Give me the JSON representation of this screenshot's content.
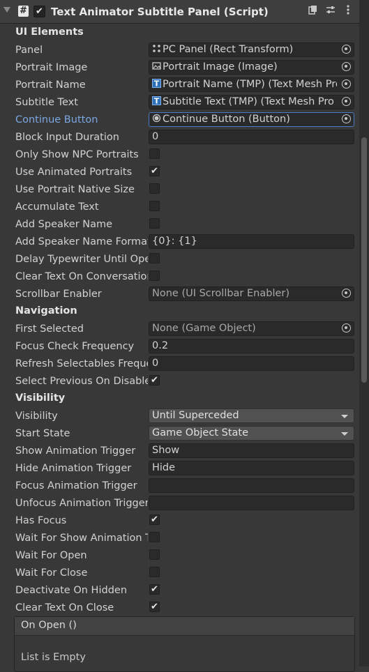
{
  "header": {
    "title": "Text Animator Subtitle Panel (Script)",
    "enabled": "✔"
  },
  "sections": {
    "ui": "UI Elements",
    "nav": "Navigation",
    "vis": "Visibility"
  },
  "rows": {
    "panel": {
      "label": "Panel",
      "value": "PC Panel (Rect Transform)"
    },
    "portrait_image": {
      "label": "Portrait Image",
      "value": "Portrait Image (Image)"
    },
    "portrait_name": {
      "label": "Portrait Name",
      "value": "Portrait Name (TMP) (Text Mesh Pro"
    },
    "subtitle_text": {
      "label": "Subtitle Text",
      "value": "Subtitle Text (TMP) (Text Mesh Pro"
    },
    "continue_button": {
      "label": "Continue Button",
      "value": "Continue Button (Button)"
    },
    "block_input": {
      "label": "Block Input Duration",
      "value": "0"
    },
    "only_npc": {
      "label": "Only Show NPC Portraits",
      "checked": ""
    },
    "use_animated": {
      "label": "Use Animated Portraits",
      "checked": "✔"
    },
    "native_size": {
      "label": "Use Portrait Native Size",
      "checked": ""
    },
    "accumulate": {
      "label": "Accumulate Text",
      "checked": ""
    },
    "add_speaker": {
      "label": "Add Speaker Name",
      "checked": ""
    },
    "speaker_format": {
      "label": "Add Speaker Name Format",
      "value": "{0}: {1}"
    },
    "delay_typewriter": {
      "label": "Delay Typewriter Until Open",
      "checked": ""
    },
    "clear_on_conv": {
      "label": "Clear Text On Conversation",
      "checked": ""
    },
    "scrollbar_enabler": {
      "label": "Scrollbar Enabler",
      "value": "None (UI Scrollbar Enabler)"
    },
    "first_selected": {
      "label": "First Selected",
      "value": "None (Game Object)"
    },
    "focus_freq": {
      "label": "Focus Check Frequency",
      "value": "0.2"
    },
    "refresh_freq": {
      "label": "Refresh Selectables Frequency",
      "value": "0"
    },
    "select_prev": {
      "label": "Select Previous On Disable",
      "checked": "✔"
    },
    "visibility": {
      "label": "Visibility",
      "value": "Until Superceded"
    },
    "start_state": {
      "label": "Start State",
      "value": "Game Object State"
    },
    "show_trigger": {
      "label": "Show Animation Trigger",
      "value": "Show"
    },
    "hide_trigger": {
      "label": "Hide Animation Trigger",
      "value": "Hide"
    },
    "focus_trigger": {
      "label": "Focus Animation Trigger",
      "value": ""
    },
    "unfocus_trigger": {
      "label": "Unfocus Animation Trigger",
      "value": ""
    },
    "has_focus": {
      "label": "Has Focus",
      "checked": "✔"
    },
    "wait_show": {
      "label": "Wait For Show Animation To Finish",
      "checked": ""
    },
    "wait_open": {
      "label": "Wait For Open",
      "checked": ""
    },
    "wait_close": {
      "label": "Wait For Close",
      "checked": ""
    },
    "deactivate_hidden": {
      "label": "Deactivate On Hidden",
      "checked": "✔"
    },
    "clear_on_close": {
      "label": "Clear Text On Close",
      "checked": "✔"
    }
  },
  "event": {
    "title": "On Open ()",
    "empty": "List is Empty"
  }
}
